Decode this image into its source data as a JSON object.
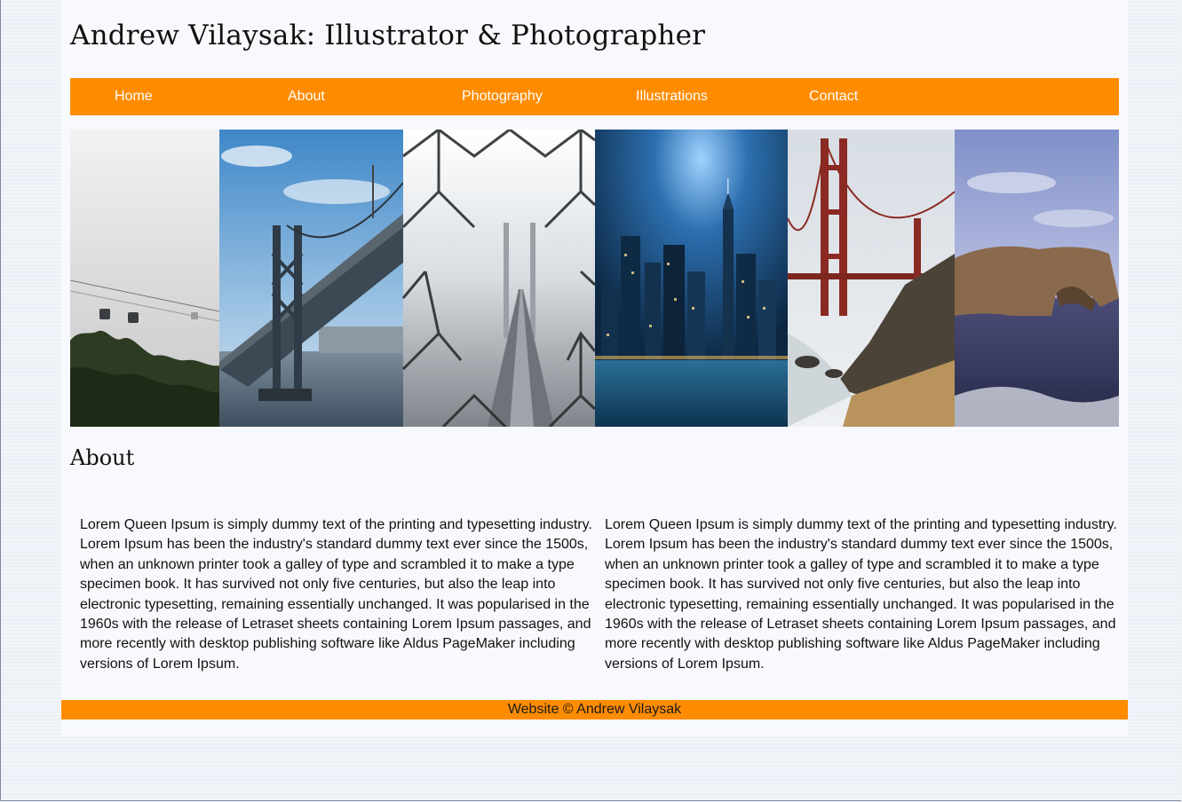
{
  "header": {
    "title": "Andrew Vilaysak: Illustrator & Photographer"
  },
  "nav": {
    "items": [
      {
        "label": "Home"
      },
      {
        "label": "About"
      },
      {
        "label": "Photography"
      },
      {
        "label": "Illustrations"
      },
      {
        "label": "Contact"
      }
    ]
  },
  "colors": {
    "accent": "#ff8c00",
    "nav_text": "#ffffff",
    "page_bg": "#f8f9fc"
  },
  "banner": {
    "photos": [
      {
        "subject": "foggy cable cars over trees"
      },
      {
        "subject": "Bay Bridge over water with city skyline"
      },
      {
        "subject": "Bay Bridge seen through chain link fence"
      },
      {
        "subject": "city skyline at night reflected in water"
      },
      {
        "subject": "Golden Gate Bridge over rocky beach"
      },
      {
        "subject": "natural rock arch over sea"
      }
    ]
  },
  "about": {
    "heading": "About",
    "paragraphs": [
      "Lorem Queen Ipsum is simply dummy text of the printing and typesetting industry. Lorem Ipsum has been the industry's standard dummy text ever since the 1500s, when an unknown printer took a galley of type and scrambled it to make a type specimen book. It has survived not only five centuries, but also the leap into electronic typesetting, remaining essentially unchanged. It was popularised in the 1960s with the release of Letraset sheets containing Lorem Ipsum passages, and more recently with desktop publishing software like Aldus PageMaker including versions of Lorem Ipsum.",
      "Lorem Queen Ipsum is simply dummy text of the printing and typesetting industry. Lorem Ipsum has been the industry's standard dummy text ever since the 1500s, when an unknown printer took a galley of type and scrambled it to make a type specimen book. It has survived not only five centuries, but also the leap into electronic typesetting, remaining essentially unchanged. It was popularised in the 1960s with the release of Letraset sheets containing Lorem Ipsum passages, and more recently with desktop publishing software like Aldus PageMaker including versions of Lorem Ipsum."
    ]
  },
  "footer": {
    "text": "Website © Andrew Vilaysak"
  }
}
